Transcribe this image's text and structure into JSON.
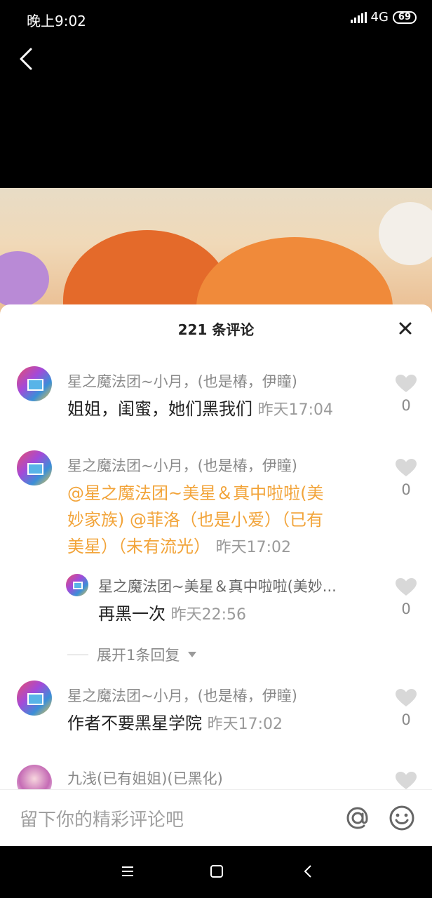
{
  "status_bar": {
    "time": "晚上9:02",
    "network": "4G",
    "battery": "69"
  },
  "sheet": {
    "title": "221 条评论"
  },
  "comments": [
    {
      "username": "星之魔法团~小月，(也是椿，伊瞳)",
      "text": "姐姐，闺蜜，她们黑我们",
      "time": "昨天17:04",
      "likes": "0"
    },
    {
      "username": "星之魔法团~小月，(也是椿，伊瞳)",
      "mention1a": "@星之魔法团~美星＆真中啦啦(美",
      "mention1b": "妙家族)",
      "mention2a": "@菲洛（也是小爱）（已有",
      "mention2b": "美星）（未有流光）",
      "time": "昨天17:02",
      "likes": "0"
    }
  ],
  "reply": {
    "username": "星之魔法团~美星＆真中啦啦(美妙...",
    "text": "再黑一次",
    "time": "昨天22:56",
    "likes": "0"
  },
  "expand_label": "展开1条回复",
  "comment3": {
    "username": "星之魔法团~小月，(也是椿，伊瞳)",
    "text": "作者不要黑星学院",
    "time": "昨天17:02",
    "likes": "0"
  },
  "comment4": {
    "username": "九浅(已有姐姐)(已黑化)"
  },
  "input": {
    "placeholder": "留下你的精彩评论吧"
  },
  "colors": {
    "mention": "#f2a43a",
    "meta": "#8a8a8a",
    "like_icon": "#d8d8d8"
  },
  "icons": {
    "back": "chevron-left-icon",
    "close": "close-icon",
    "like": "heart-icon",
    "at": "at-icon",
    "emoji": "smiley-icon",
    "nav": [
      "menu-icon",
      "home-square-icon",
      "back-triangle-icon"
    ]
  }
}
